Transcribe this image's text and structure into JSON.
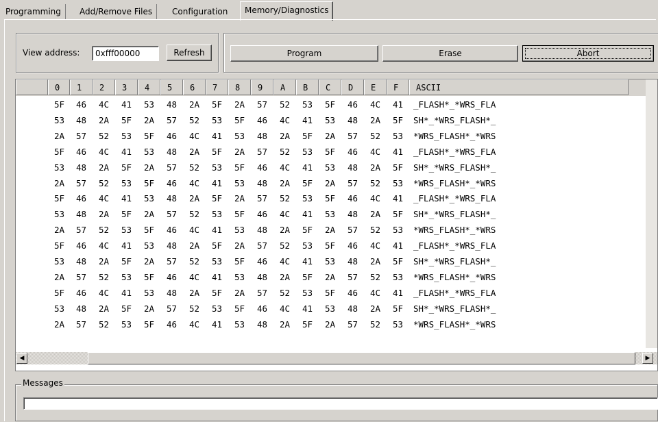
{
  "tabs": [
    "Programming",
    "Add/Remove Files",
    "Configuration",
    "Memory/Diagnostics"
  ],
  "view_address": {
    "label": "View address:",
    "value": "0xfff00000",
    "refresh_label": "Refresh"
  },
  "actions": {
    "program": "Program",
    "erase": "Erase",
    "abort": "Abort"
  },
  "grid": {
    "columns": [
      "",
      "0",
      "1",
      "2",
      "3",
      "4",
      "5",
      "6",
      "7",
      "8",
      "9",
      "A",
      "B",
      "C",
      "D",
      "E",
      "F",
      "ASCII"
    ],
    "rows": [
      {
        "hex": [
          "5F",
          "46",
          "4C",
          "41",
          "53",
          "48",
          "2A",
          "5F",
          "2A",
          "57",
          "52",
          "53",
          "5F",
          "46",
          "4C",
          "41"
        ],
        "ascii": "_FLASH*_*WRS_FLA"
      },
      {
        "hex": [
          "53",
          "48",
          "2A",
          "5F",
          "2A",
          "57",
          "52",
          "53",
          "5F",
          "46",
          "4C",
          "41",
          "53",
          "48",
          "2A",
          "5F"
        ],
        "ascii": "SH*_*WRS_FLASH*_"
      },
      {
        "hex": [
          "2A",
          "57",
          "52",
          "53",
          "5F",
          "46",
          "4C",
          "41",
          "53",
          "48",
          "2A",
          "5F",
          "2A",
          "57",
          "52",
          "53"
        ],
        "ascii": "*WRS_FLASH*_*WRS"
      },
      {
        "hex": [
          "5F",
          "46",
          "4C",
          "41",
          "53",
          "48",
          "2A",
          "5F",
          "2A",
          "57",
          "52",
          "53",
          "5F",
          "46",
          "4C",
          "41"
        ],
        "ascii": "_FLASH*_*WRS_FLA"
      },
      {
        "hex": [
          "53",
          "48",
          "2A",
          "5F",
          "2A",
          "57",
          "52",
          "53",
          "5F",
          "46",
          "4C",
          "41",
          "53",
          "48",
          "2A",
          "5F"
        ],
        "ascii": "SH*_*WRS_FLASH*_"
      },
      {
        "hex": [
          "2A",
          "57",
          "52",
          "53",
          "5F",
          "46",
          "4C",
          "41",
          "53",
          "48",
          "2A",
          "5F",
          "2A",
          "57",
          "52",
          "53"
        ],
        "ascii": "*WRS_FLASH*_*WRS"
      },
      {
        "hex": [
          "5F",
          "46",
          "4C",
          "41",
          "53",
          "48",
          "2A",
          "5F",
          "2A",
          "57",
          "52",
          "53",
          "5F",
          "46",
          "4C",
          "41"
        ],
        "ascii": "_FLASH*_*WRS_FLA"
      },
      {
        "hex": [
          "53",
          "48",
          "2A",
          "5F",
          "2A",
          "57",
          "52",
          "53",
          "5F",
          "46",
          "4C",
          "41",
          "53",
          "48",
          "2A",
          "5F"
        ],
        "ascii": "SH*_*WRS_FLASH*_"
      },
      {
        "hex": [
          "2A",
          "57",
          "52",
          "53",
          "5F",
          "46",
          "4C",
          "41",
          "53",
          "48",
          "2A",
          "5F",
          "2A",
          "57",
          "52",
          "53"
        ],
        "ascii": "*WRS_FLASH*_*WRS"
      },
      {
        "hex": [
          "5F",
          "46",
          "4C",
          "41",
          "53",
          "48",
          "2A",
          "5F",
          "2A",
          "57",
          "52",
          "53",
          "5F",
          "46",
          "4C",
          "41"
        ],
        "ascii": "_FLASH*_*WRS_FLA"
      },
      {
        "hex": [
          "53",
          "48",
          "2A",
          "5F",
          "2A",
          "57",
          "52",
          "53",
          "5F",
          "46",
          "4C",
          "41",
          "53",
          "48",
          "2A",
          "5F"
        ],
        "ascii": "SH*_*WRS_FLASH*_"
      },
      {
        "hex": [
          "2A",
          "57",
          "52",
          "53",
          "5F",
          "46",
          "4C",
          "41",
          "53",
          "48",
          "2A",
          "5F",
          "2A",
          "57",
          "52",
          "53"
        ],
        "ascii": "*WRS_FLASH*_*WRS"
      },
      {
        "hex": [
          "5F",
          "46",
          "4C",
          "41",
          "53",
          "48",
          "2A",
          "5F",
          "2A",
          "57",
          "52",
          "53",
          "5F",
          "46",
          "4C",
          "41"
        ],
        "ascii": "_FLASH*_*WRS_FLA"
      },
      {
        "hex": [
          "53",
          "48",
          "2A",
          "5F",
          "2A",
          "57",
          "52",
          "53",
          "5F",
          "46",
          "4C",
          "41",
          "53",
          "48",
          "2A",
          "5F"
        ],
        "ascii": "SH*_*WRS_FLASH*_"
      },
      {
        "hex": [
          "2A",
          "57",
          "52",
          "53",
          "5F",
          "46",
          "4C",
          "41",
          "53",
          "48",
          "2A",
          "5F",
          "2A",
          "57",
          "52",
          "53"
        ],
        "ascii": "*WRS_FLASH*_*WRS"
      }
    ]
  },
  "scrollbar": {
    "left_icon": "arrow-left-icon",
    "right_icon": "arrow-right-icon"
  },
  "messages": {
    "label": "Messages",
    "text": ""
  }
}
